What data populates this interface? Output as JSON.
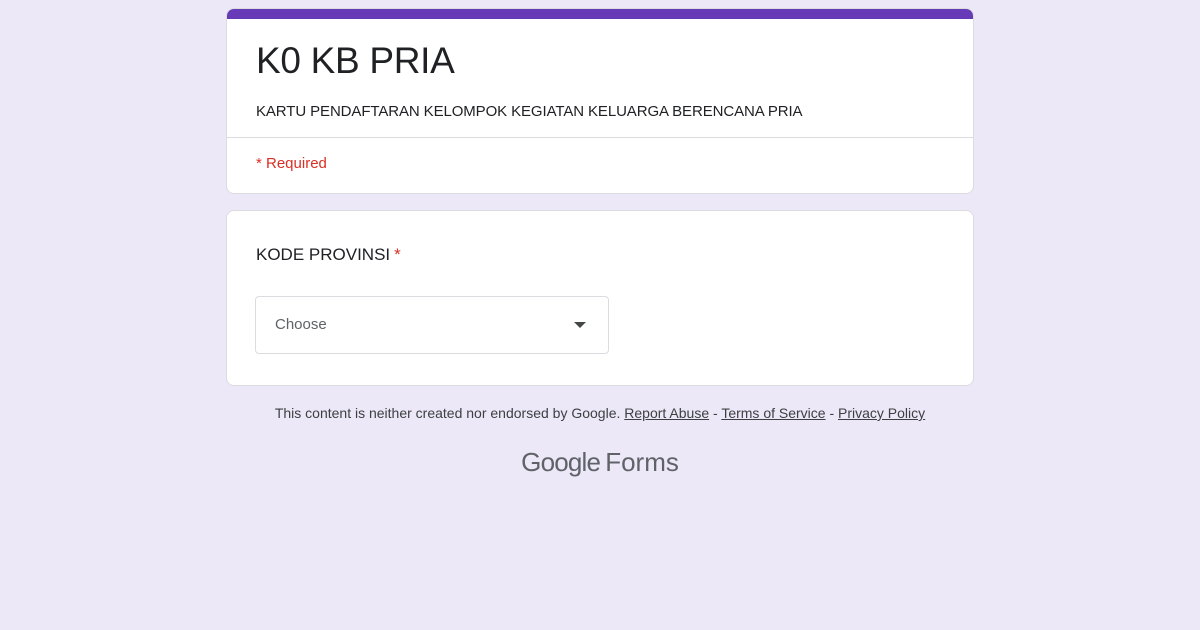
{
  "form": {
    "title": "K0 KB PRIA",
    "description": "KARTU PENDAFTARAN KELOMPOK KEGIATAN KELUARGA BERENCANA PRIA",
    "required_note": "* Required",
    "accent_color": "#673ab7",
    "background_color": "#ede8f7"
  },
  "question": {
    "label": "KODE PROVINSI",
    "required_marker": "*",
    "dropdown_value": "Choose",
    "dropdown_icon": "caret-down-icon"
  },
  "footer": {
    "disclaimer": "This content is neither created nor endorsed by Google.",
    "report_abuse": "Report Abuse",
    "separator": "-",
    "terms": "Terms of Service",
    "privacy": "Privacy Policy"
  },
  "logo": {
    "brand": "Google",
    "product": "Forms"
  }
}
